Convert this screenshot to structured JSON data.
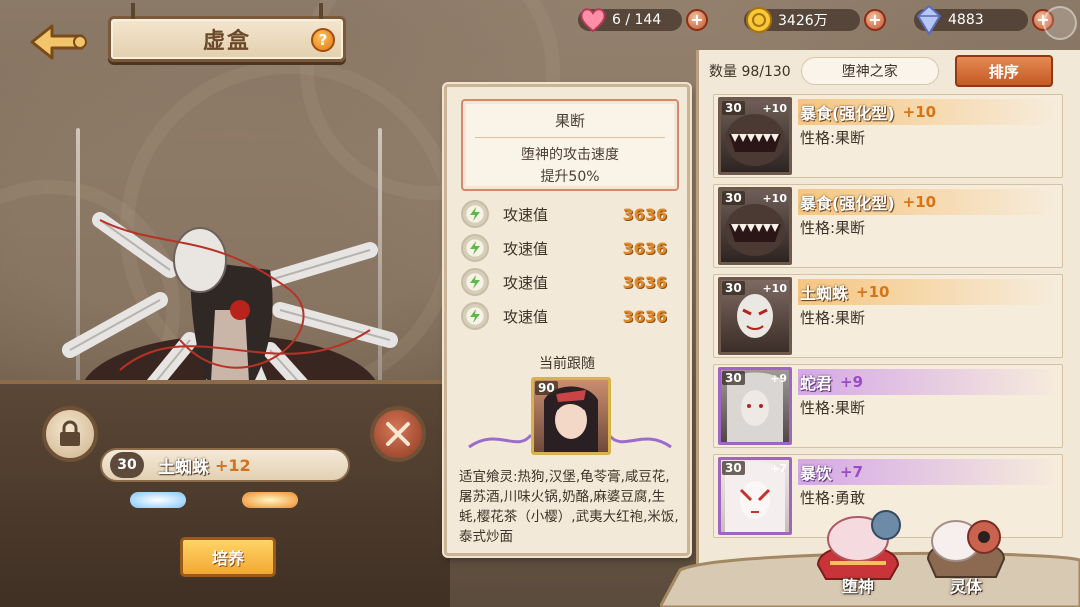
{
  "header": {
    "title": "虚盒",
    "help_label": "?"
  },
  "resources": [
    {
      "icon": "heart-icon",
      "value": "6 / 144",
      "plus": "+"
    },
    {
      "icon": "gold-coin-icon",
      "value": "3426万",
      "plus": "+"
    },
    {
      "icon": "crystal-icon",
      "value": "4883",
      "plus": "+"
    }
  ],
  "selected": {
    "level": "30",
    "name": "土蜘蛛",
    "plus": "+12",
    "cultivate_label": "培养"
  },
  "detail": {
    "trait_name": "果断",
    "trait_desc_1": "堕神的攻击速度",
    "trait_desc_2": "提升50%",
    "stats": [
      {
        "label": "攻速值",
        "value": "3636"
      },
      {
        "label": "攻速值",
        "value": "3636"
      },
      {
        "label": "攻速值",
        "value": "3636"
      },
      {
        "label": "攻速值",
        "value": "3636"
      }
    ],
    "follow_title": "当前跟随",
    "follow_level": "90",
    "food": "适宜飨灵:热狗,汉堡,龟苓膏,咸豆花,屠苏酒,川味火锅,奶酪,麻婆豆腐,生蚝,樱花茶（小樱）,武夷大红袍,米饭,泰式炒面"
  },
  "list": {
    "count": "数量 98/130",
    "filter": "堕神之家",
    "sort_label": "排序",
    "items": [
      {
        "level": "30",
        "thumb_plus": "+10",
        "name": "暴食(强化型)",
        "plus": "+10",
        "trait": "性格:果断",
        "rarity": "orange"
      },
      {
        "level": "30",
        "thumb_plus": "+10",
        "name": "暴食(强化型)",
        "plus": "+10",
        "trait": "性格:果断",
        "rarity": "orange"
      },
      {
        "level": "30",
        "thumb_plus": "+10",
        "name": "土蜘蛛",
        "plus": "+10",
        "trait": "性格:果断",
        "rarity": "orange"
      },
      {
        "level": "30",
        "thumb_plus": "+9",
        "name": "蛇君",
        "plus": "+9",
        "trait": "性格:果断",
        "rarity": "purple"
      },
      {
        "level": "30",
        "thumb_plus": "+7",
        "name": "暴饮",
        "plus": "+7",
        "trait": "性格:勇敢",
        "rarity": "purple"
      }
    ]
  },
  "categories": [
    {
      "label": "堕神"
    },
    {
      "label": "灵体"
    }
  ]
}
